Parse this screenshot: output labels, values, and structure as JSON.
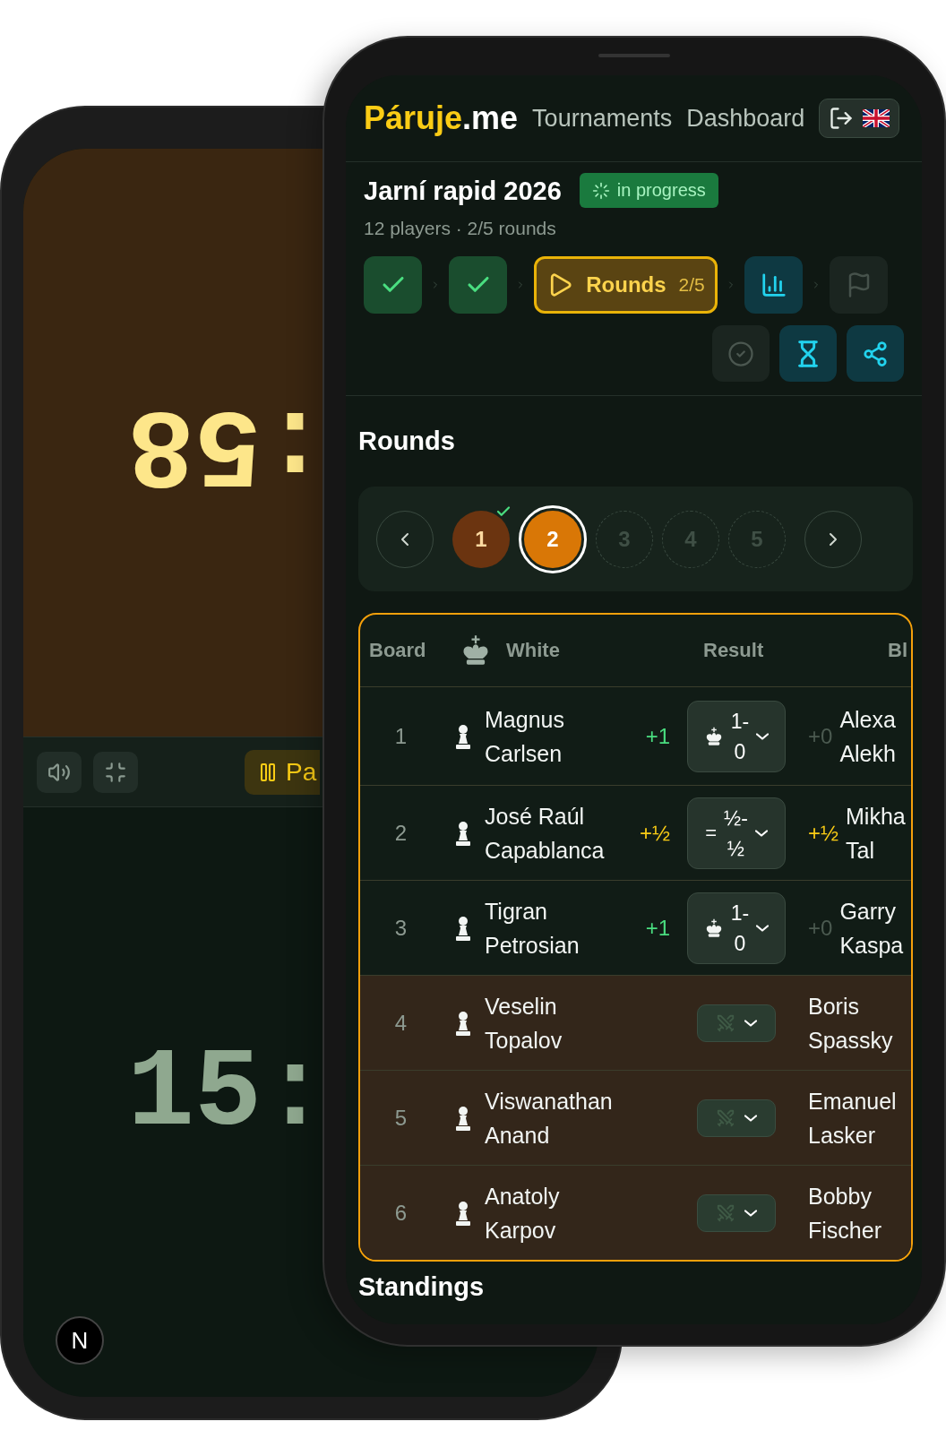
{
  "left_device": {
    "top_clock": ":58",
    "toolbar": [
      {
        "kind": "sound"
      },
      {
        "kind": "minimize"
      }
    ],
    "pause_button": "Pa",
    "bottom_clock": "15:",
    "dev_badge": "N"
  },
  "header": {
    "brand": "Páruje",
    "brand_suffix": ".me",
    "nav": [
      "Tournaments",
      "Dashboard"
    ]
  },
  "tournament": {
    "title": "Jarní rapid 2026",
    "status": "in progress",
    "meta": "12 players · 2/5 rounds",
    "steps": [
      {
        "kind": "check",
        "completed": true,
        "selected": false,
        "disabled": false
      },
      {
        "kind": "check",
        "completed": true,
        "selected": false,
        "disabled": false
      },
      {
        "kind": "rounds",
        "completed": false,
        "selected": true,
        "disabled": false,
        "label": "Rounds",
        "count": "2/5"
      },
      {
        "kind": "chart",
        "completed": false,
        "selected": false,
        "disabled": false
      },
      {
        "kind": "flag",
        "completed": false,
        "selected": false,
        "disabled": true
      }
    ],
    "actions": [
      {
        "kind": "check-circle",
        "disabled": true
      },
      {
        "kind": "hourglass",
        "disabled": false
      },
      {
        "kind": "share",
        "disabled": false
      }
    ]
  },
  "rounds": {
    "title": "Rounds",
    "items": [
      {
        "label": "1",
        "kind": "completed",
        "selected": false
      },
      {
        "label": "2",
        "kind": "active",
        "selected": true
      },
      {
        "label": "3",
        "kind": "upcoming",
        "selected": false
      },
      {
        "label": "4",
        "kind": "upcoming",
        "selected": false
      },
      {
        "label": "5",
        "kind": "upcoming",
        "selected": false
      }
    ]
  },
  "pairings": {
    "columns": [
      "Board",
      "White",
      "Result",
      "Bl"
    ],
    "rows": [
      {
        "board": "1",
        "white": "Magnus Carlsen",
        "white_score": {
          "text": "+1",
          "color": "#4ade80"
        },
        "result": {
          "kind": "white_win",
          "text": "1-0"
        },
        "black_score": {
          "text": "+0",
          "color": "#4b5a50"
        },
        "black": "Alexa Alekh",
        "pending": false
      },
      {
        "board": "2",
        "white": "José Raúl Capablanca",
        "white_score": {
          "text": "+½",
          "color": "#facc15"
        },
        "result": {
          "kind": "draw",
          "symbol": "=",
          "text": "½-½"
        },
        "black_score": {
          "text": "+½",
          "color": "#facc15"
        },
        "black": "Mikha Tal",
        "pending": false
      },
      {
        "board": "3",
        "white": "Tigran Petrosian",
        "white_score": {
          "text": "+1",
          "color": "#4ade80"
        },
        "result": {
          "kind": "white_win",
          "text": "1-0"
        },
        "black_score": {
          "text": "+0",
          "color": "#4b5a50"
        },
        "black": "Garry Kaspa",
        "pending": false
      },
      {
        "board": "4",
        "white": "Veselin Topalov",
        "result": {
          "kind": "pending"
        },
        "black": "Boris Spassky",
        "pending": true
      },
      {
        "board": "5",
        "white": "Viswanathan Anand",
        "result": {
          "kind": "pending"
        },
        "black": "Emanuel Lasker",
        "pending": true
      },
      {
        "board": "6",
        "white": "Anatoly Karpov",
        "result": {
          "kind": "pending"
        },
        "black": "Bobby Fischer",
        "pending": true
      }
    ]
  },
  "next_section": "Standings"
}
